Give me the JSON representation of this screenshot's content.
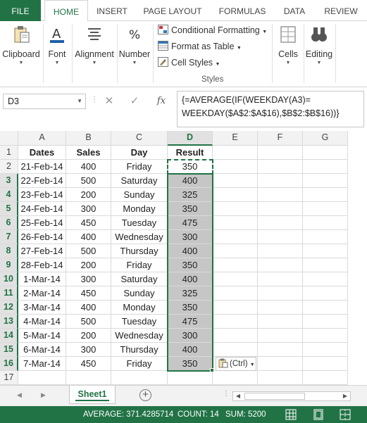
{
  "ribbon_tabs": [
    "FILE",
    "HOME",
    "INSERT",
    "PAGE LAYOUT",
    "FORMULAS",
    "DATA",
    "REVIEW"
  ],
  "ribbon": {
    "clipboard": "Clipboard",
    "font": "Font",
    "alignment": "Alignment",
    "number": "Number",
    "conditional_formatting": "Conditional Formatting",
    "format_as_table": "Format as Table",
    "cell_styles": "Cell Styles",
    "styles": "Styles",
    "cells": "Cells",
    "editing": "Editing"
  },
  "formula_bar": {
    "name_box": "D3",
    "formula_line1": "{=AVERAGE(IF(WEEKDAY(A3)=",
    "formula_line2": "WEEKDAY($A$2:$A$16),$B$2:$B$16))}"
  },
  "columns": [
    "A",
    "B",
    "C",
    "D",
    "E",
    "F",
    "G"
  ],
  "rows": [
    [
      "1",
      "Dates",
      "Sales",
      "Day",
      "Result"
    ],
    [
      "2",
      "21-Feb-14",
      "400",
      "Friday",
      "350"
    ],
    [
      "3",
      "22-Feb-14",
      "500",
      "Saturday",
      "400"
    ],
    [
      "4",
      "23-Feb-14",
      "200",
      "Sunday",
      "325"
    ],
    [
      "5",
      "24-Feb-14",
      "300",
      "Monday",
      "350"
    ],
    [
      "6",
      "25-Feb-14",
      "450",
      "Tuesday",
      "475"
    ],
    [
      "7",
      "26-Feb-14",
      "400",
      "Wednesday",
      "300"
    ],
    [
      "8",
      "27-Feb-14",
      "500",
      "Thursday",
      "400"
    ],
    [
      "9",
      "28-Feb-14",
      "200",
      "Friday",
      "350"
    ],
    [
      "10",
      "1-Mar-14",
      "300",
      "Saturday",
      "400"
    ],
    [
      "11",
      "2-Mar-14",
      "450",
      "Sunday",
      "325"
    ],
    [
      "12",
      "3-Mar-14",
      "400",
      "Monday",
      "350"
    ],
    [
      "13",
      "4-Mar-14",
      "500",
      "Tuesday",
      "475"
    ],
    [
      "14",
      "5-Mar-14",
      "200",
      "Wednesday",
      "300"
    ],
    [
      "15",
      "6-Mar-14",
      "300",
      "Thursday",
      "400"
    ],
    [
      "16",
      "7-Mar-14",
      "450",
      "Friday",
      "350"
    ],
    [
      "17",
      "",
      "",
      "",
      ""
    ]
  ],
  "paste_options": "(Ctrl)",
  "sheet_tab": "Sheet1",
  "status": {
    "average": "AVERAGE: 371.4285714",
    "count": "COUNT: 14",
    "sum": "SUM: 5200"
  },
  "colors": {
    "accent": "#217346",
    "selected_fill": "#c6c6c6",
    "header_bg": "#f2f2f2"
  }
}
